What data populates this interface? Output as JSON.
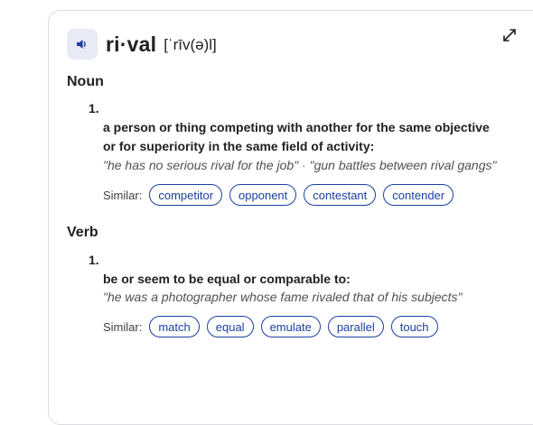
{
  "entry": {
    "word": "ri·val",
    "phonetic": "[ˈrīv(ə)l]",
    "speaker_icon": "speaker-icon",
    "expand_icon": "expand-icon"
  },
  "noun": {
    "label": "Noun",
    "number": "1.",
    "definition_line1": "a person or thing competing with another for the same objective",
    "definition_line2": "or for superiority in the same field of activity:",
    "example1": "\"he has no serious rival for the job\"",
    "separator": " · ",
    "example2": "\"gun battles between rival gangs\"",
    "similar_label": "Similar:",
    "similar": [
      "competitor",
      "opponent",
      "contestant",
      "contender"
    ]
  },
  "verb": {
    "label": "Verb",
    "number": "1.",
    "definition": "be or seem to be equal or comparable to:",
    "example": "\"he was a photographer whose fame rivaled that of his subjects\"",
    "similar_label": "Similar:",
    "similar": [
      "match",
      "equal",
      "emulate",
      "parallel",
      "touch"
    ]
  },
  "colors": {
    "accent": "#1a3fa0",
    "speaker_bg": "#e8eaf6",
    "border": "#dadce0"
  }
}
